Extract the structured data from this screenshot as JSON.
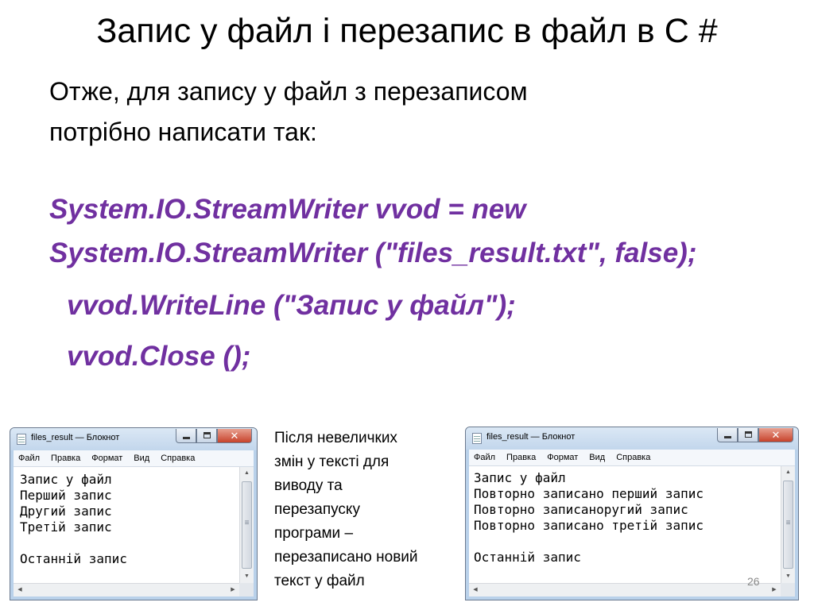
{
  "slide": {
    "title": "Запис у файл і перезапис в файл в С #",
    "intro_line1": "Отже, для запису у файл з перезаписом",
    "intro_line2": "потрібно написати так:",
    "code": [
      "System.IO.StreamWriter vvod = new",
      "System.IO.StreamWriter (\"files_result.txt\", false);",
      "vvod.WriteLine (\"Запис у файл\");",
      "vvod.Close ();"
    ],
    "caption": [
      "Після невеличких",
      "змін у тексті для",
      "виводу та",
      "перезапуску",
      "програми –",
      "перезаписано новий",
      "текст у файл"
    ],
    "page_number": "26",
    "colors": {
      "code": "#7030a0"
    }
  },
  "notepad_before": {
    "title": "files_result — Блокнот",
    "menu": [
      "Файл",
      "Правка",
      "Формат",
      "Вид",
      "Справка"
    ],
    "lines": [
      "Запис у файл",
      "Перший запис",
      "Другий запис",
      "Третій запис",
      "",
      "Останній запис"
    ]
  },
  "notepad_after": {
    "title": "files_result — Блокнот",
    "menu": [
      "Файл",
      "Правка",
      "Формат",
      "Вид",
      "Справка"
    ],
    "lines": [
      "Запис у файл",
      "Повторно записано перший запис",
      "Повторно записаноругий запис",
      "Повторно записано третій запис",
      "",
      "Останній запис"
    ]
  }
}
